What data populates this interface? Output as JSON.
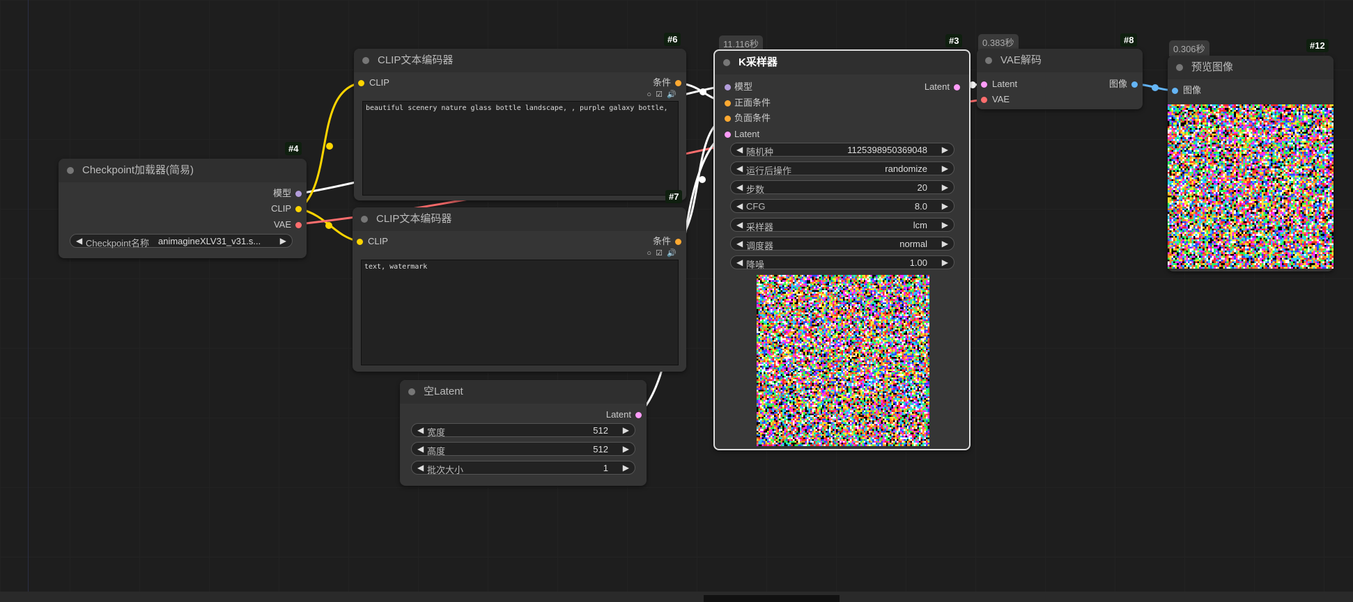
{
  "canvas": {
    "background": "#1e1e1e"
  },
  "colors": {
    "model": "#b39ddb",
    "clip": "#ffd500",
    "vae": "#ff6e6e",
    "cond": "#ffa931",
    "latent": "#ff9cf9",
    "image": "#64b5f6"
  },
  "nodes": {
    "checkpoint": {
      "id": "#4",
      "title": "Checkpoint加载器(简易)",
      "outputs": {
        "model": "模型",
        "clip": "CLIP",
        "vae": "VAE"
      },
      "widget": {
        "name": "Checkpoint名称",
        "value": "animagineXLV31_v31.s..."
      }
    },
    "clip_pos": {
      "id": "#6",
      "title": "CLIP文本编码器",
      "input": "CLIP",
      "output": "条件",
      "text": "beautiful scenery nature glass bottle landscape, , purple galaxy bottle,"
    },
    "clip_neg": {
      "id": "#7",
      "title": "CLIP文本编码器",
      "input": "CLIP",
      "output": "条件",
      "text": "text, watermark"
    },
    "empty_latent": {
      "title": "空Latent",
      "output": "Latent",
      "widgets": [
        {
          "name": "宽度",
          "value": "512"
        },
        {
          "name": "高度",
          "value": "512"
        },
        {
          "name": "批次大小",
          "value": "1"
        }
      ]
    },
    "ksampler": {
      "id": "#3",
      "time": "11.116秒",
      "title": "K采样器",
      "inputs": {
        "model": "模型",
        "positive": "正面条件",
        "negative": "负面条件",
        "latent": "Latent"
      },
      "output": "Latent",
      "widgets": [
        {
          "name": "随机种",
          "value": "1125398950369048"
        },
        {
          "name": "运行后操作",
          "value": "randomize"
        },
        {
          "name": "步数",
          "value": "20"
        },
        {
          "name": "CFG",
          "value": "8.0"
        },
        {
          "name": "采样器",
          "value": "lcm"
        },
        {
          "name": "调度器",
          "value": "normal"
        },
        {
          "name": "降噪",
          "value": "1.00"
        }
      ]
    },
    "vae_decode": {
      "id": "#8",
      "time": "0.383秒",
      "title": "VAE解码",
      "inputs": {
        "latent": "Latent",
        "vae": "VAE"
      },
      "output": "图像"
    },
    "preview": {
      "id": "#12",
      "time": "0.306秒",
      "title": "预览图像",
      "input": "图像"
    }
  },
  "icons": {
    "arrow_left": "◀",
    "arrow_right": "▶",
    "checkbox": "☑",
    "speaker": "🔊"
  }
}
